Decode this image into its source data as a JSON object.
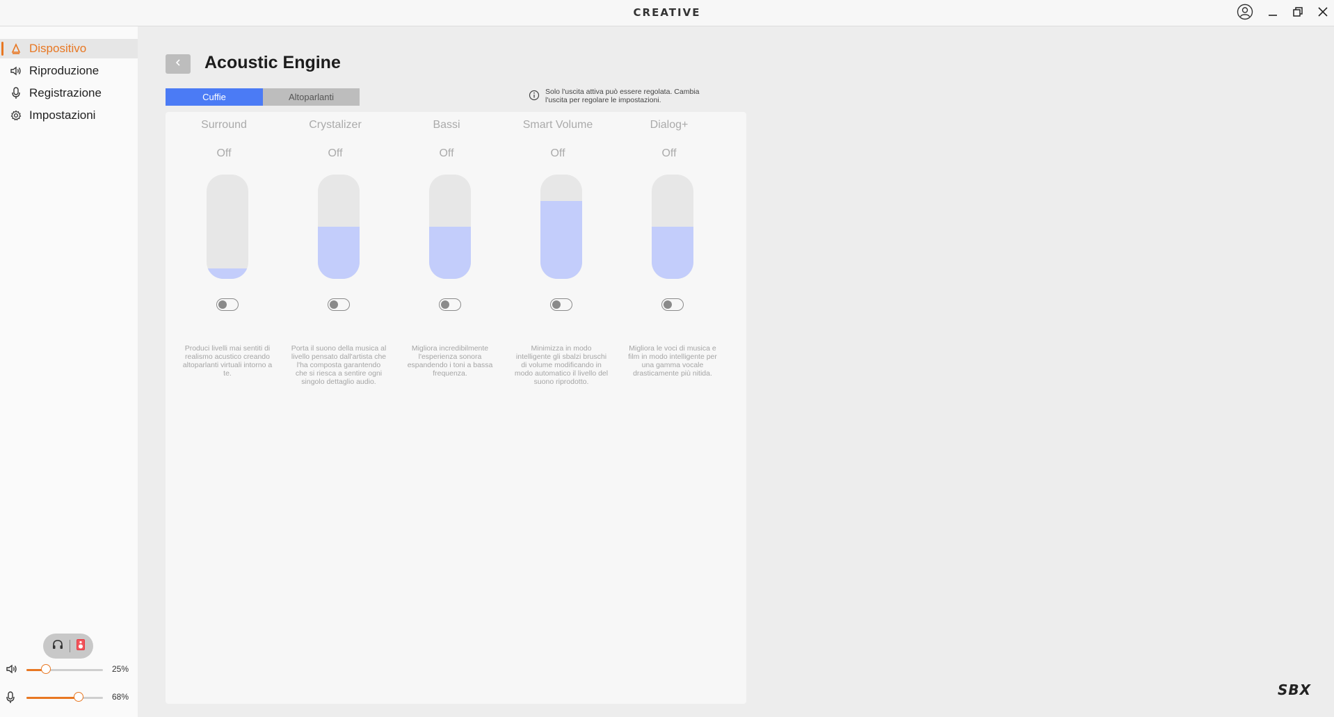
{
  "titlebar": {
    "brand": "CREATIVE"
  },
  "sidebar": {
    "items": [
      {
        "label": "Dispositivo",
        "icon": "device-icon",
        "active": true
      },
      {
        "label": "Riproduzione",
        "icon": "speaker-icon",
        "active": false
      },
      {
        "label": "Registrazione",
        "icon": "microphone-icon",
        "active": false
      },
      {
        "label": "Impostazioni",
        "icon": "gear-icon",
        "active": false
      }
    ],
    "output_switch": {
      "left_icon": "headphones-icon",
      "right_icon": "speaker-box-icon",
      "selected": "speaker"
    },
    "playback_volume": {
      "value": 0.25,
      "label": "25%",
      "icon": "speaker-icon"
    },
    "mic_volume": {
      "value": 0.68,
      "label": "68%",
      "icon": "microphone-icon"
    }
  },
  "main": {
    "title": "Acoustic Engine",
    "tabs": [
      {
        "label": "Cuffie",
        "active": true
      },
      {
        "label": "Altoparlanti",
        "active": false
      }
    ],
    "info": "Solo l'uscita attiva può essere regolata. Cambia l'uscita per regolare le impostazioni.",
    "effects": [
      {
        "title": "Surround",
        "status": "Off",
        "level": 0.1,
        "enabled": false,
        "description": "Produci livelli mai sentiti di realismo acustico creando altoparlanti virtuali intorno a te."
      },
      {
        "title": "Crystalizer",
        "status": "Off",
        "level": 0.5,
        "enabled": false,
        "description": "Porta il suono della musica al livello pensato dall'artista che l'ha composta garantendo che si riesca a sentire ogni singolo dettaglio audio."
      },
      {
        "title": "Bassi",
        "status": "Off",
        "level": 0.5,
        "enabled": false,
        "description": "Migliora incredibilmente l'esperienza sonora espandendo i toni a bassa frequenza."
      },
      {
        "title": "Smart Volume",
        "status": "Off",
        "level": 0.75,
        "enabled": false,
        "description": "Minimizza in modo intelligente gli sbalzi bruschi di volume modificando in modo automatico il livello del suono riprodotto."
      },
      {
        "title": "Dialog+",
        "status": "Off",
        "level": 0.5,
        "enabled": false,
        "description": "Migliora le voci di musica e film in modo intelligente per una gamma vocale drasticamente più nitida."
      }
    ],
    "footer_logo": "SBX"
  },
  "colors": {
    "accent": "#e87722",
    "tab_active": "#4b7bf5",
    "slider_fill": "#c3cdfb"
  }
}
